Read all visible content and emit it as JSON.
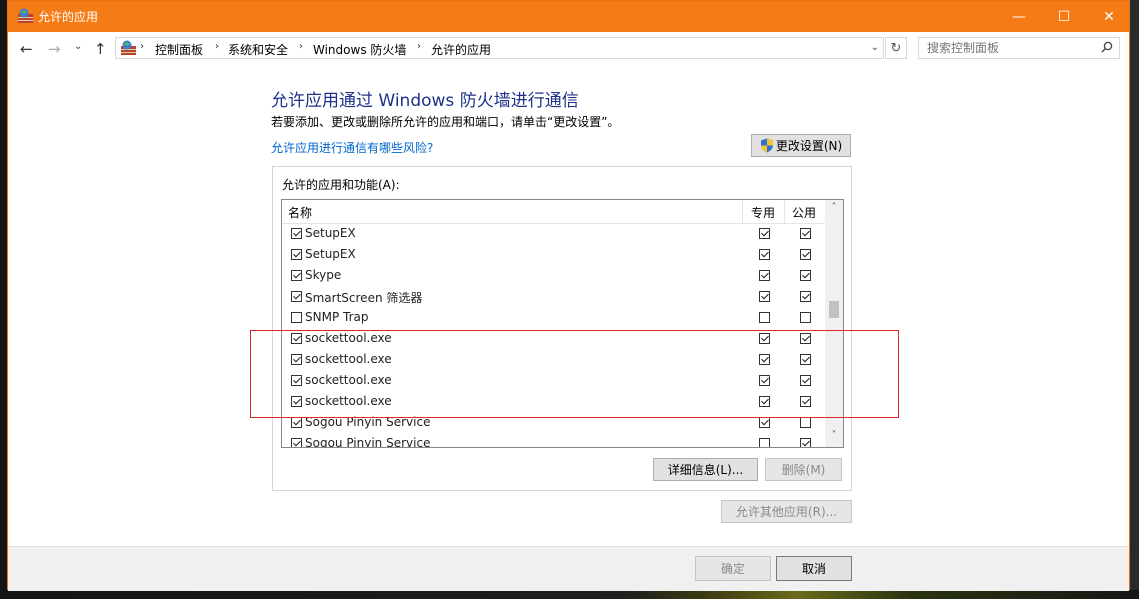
{
  "window": {
    "title": "允许的应用",
    "controls": {
      "minimize": "—",
      "maximize": "☐",
      "close": "✕"
    }
  },
  "navigation": {
    "back_glyph": "←",
    "forward_glyph": "→",
    "recent_glyph": "⌄",
    "up_glyph": "↑",
    "breadcrumbs": [
      "控制面板",
      "系统和安全",
      "Windows 防火墙",
      "允许的应用"
    ],
    "separator": "›",
    "dropdown_glyph": "⌄",
    "refresh_glyph": "↻",
    "search_placeholder": "搜索控制面板"
  },
  "content": {
    "heading": "允许应用通过 Windows 防火墙进行通信",
    "subtext": "若要添加、更改或删除所允许的应用和端口，请单击“更改设置”。",
    "risk_link": "允许应用进行通信有哪些风险?",
    "change_settings_label": "更改设置(N)",
    "group_label": "允许的应用和功能(A):",
    "columns": {
      "name": "名称",
      "private": "专用",
      "public": "公用"
    },
    "rows": [
      {
        "name": "SetupEX",
        "enabled": true,
        "private": true,
        "public": true
      },
      {
        "name": "SetupEX",
        "enabled": true,
        "private": true,
        "public": true
      },
      {
        "name": "Skype",
        "enabled": true,
        "private": true,
        "public": true
      },
      {
        "name": "SmartScreen 筛选器",
        "enabled": true,
        "private": true,
        "public": true
      },
      {
        "name": "SNMP Trap",
        "enabled": false,
        "private": false,
        "public": false
      },
      {
        "name": "sockettool.exe",
        "enabled": true,
        "private": true,
        "public": true
      },
      {
        "name": "sockettool.exe",
        "enabled": true,
        "private": true,
        "public": true
      },
      {
        "name": "sockettool.exe",
        "enabled": true,
        "private": true,
        "public": true
      },
      {
        "name": "sockettool.exe",
        "enabled": true,
        "private": true,
        "public": true
      },
      {
        "name": "Sogou Pinyin Service",
        "enabled": true,
        "private": true,
        "public": false
      },
      {
        "name": "Sogou Pinyin Service",
        "enabled": true,
        "private": false,
        "public": true
      }
    ],
    "scroll_up_glyph": "˄",
    "scroll_down_glyph": "˅",
    "details_label": "详细信息(L)...",
    "remove_label": "删除(M)",
    "allow_other_label": "允许其他应用(R)..."
  },
  "footer": {
    "ok_label": "确定",
    "cancel_label": "取消"
  },
  "colors": {
    "title_bar": "#f47b16",
    "heading": "#1e3287",
    "link": "#0066cc",
    "highlight_box": "#e0262a"
  }
}
